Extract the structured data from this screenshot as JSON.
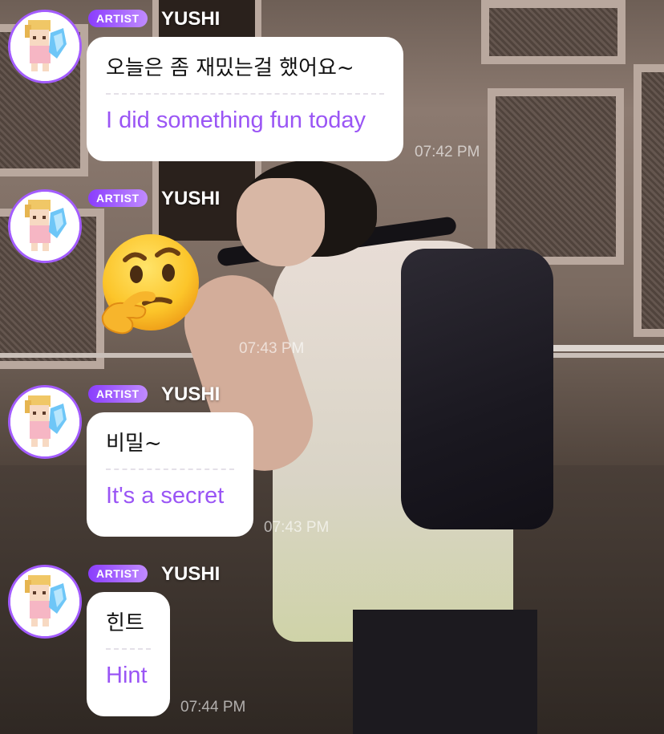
{
  "messages": [
    {
      "badge": "ARTIST",
      "sender": "YUSHI",
      "korean": "오늘은 좀 재밌는걸 했어요~",
      "english": "I did something fun today",
      "time": "07:42 PM"
    },
    {
      "badge": "ARTIST",
      "sender": "YUSHI",
      "emoji": "thinking-face",
      "time": "07:43 PM"
    },
    {
      "badge": "ARTIST",
      "sender": "YUSHI",
      "korean": "비밀~",
      "english": "It's a secret",
      "time": "07:43 PM"
    },
    {
      "badge": "ARTIST",
      "sender": "YUSHI",
      "korean": "힌트",
      "english": "Hint",
      "time": "07:44 PM"
    }
  ],
  "colors": {
    "accent_purple": "#9a55f5",
    "badge_start": "#8a3dfd",
    "badge_end": "#c08bff",
    "bubble_bg": "#ffffff"
  }
}
